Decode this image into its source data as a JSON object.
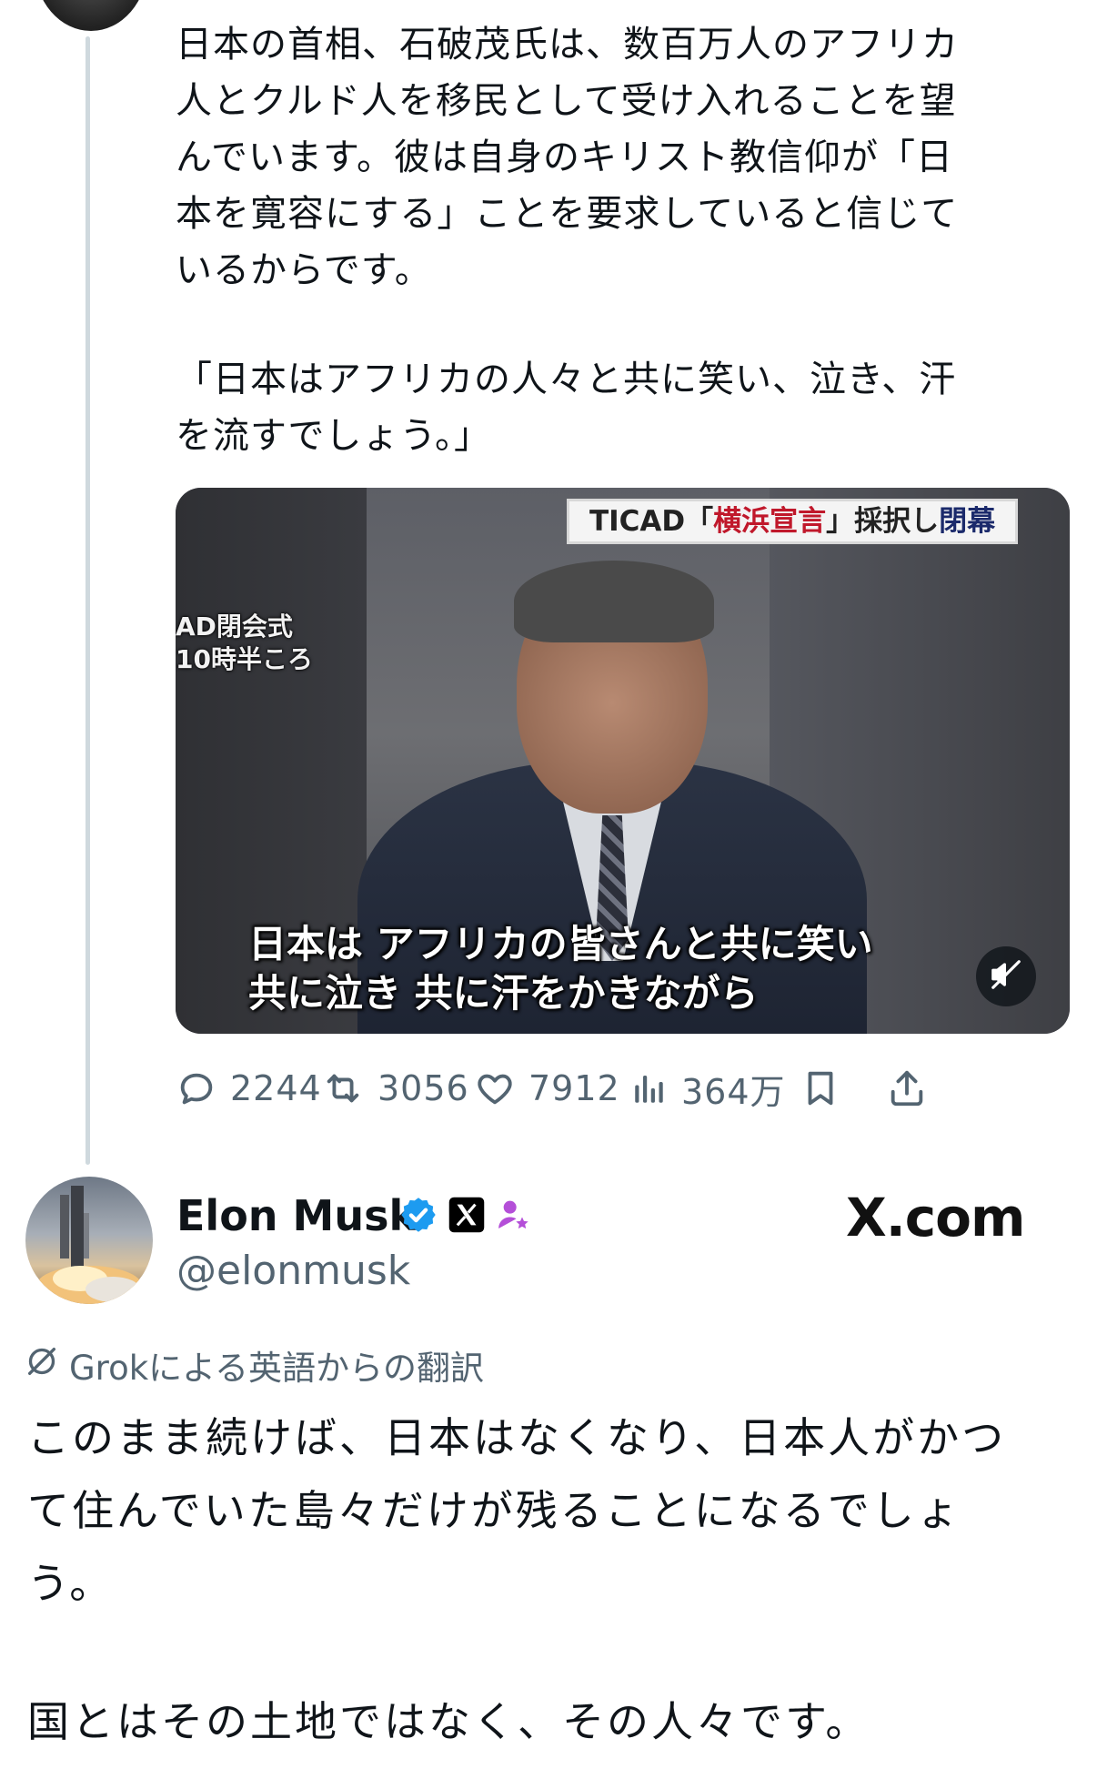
{
  "post": {
    "paragraph1": "日本の首相、石破茂氏は、数百万人のアフリカ\n人とクルド人を移民として受け入れることを望\nんでいます。彼は自身のキリスト教信仰が「日\n本を寛容にする」ことを要求していると信じて\nいるからです。",
    "quote": "「日本はアフリカの人々と共に笑い、泣き、汗\nを流すでしょう。」",
    "video": {
      "banner_prefix": "TICAD「",
      "banner_red": "横浜宣言",
      "banner_mid": "」採択し",
      "banner_end": "閉幕",
      "side_caption": "AD閉会式\n10時半ころ",
      "subtitle": "日本は アフリカの皆さんと共に笑い\n共に泣き 共に汗をかきながら"
    },
    "actions": {
      "replies": "2244",
      "reposts": "3056",
      "likes": "7912",
      "views": "364万"
    }
  },
  "reply": {
    "author_name": "Elon Musk",
    "author_handle": "@elonmusk",
    "watermark": "X.com",
    "translation_label": "Grokによる英語からの翻訳",
    "text1": "このまま続けば、日本はなくなり、日本人がかつ\nて住んでいた島々だけが残ることになるでしょ\nう。",
    "text2": "国とはその土地ではなく、その人々です。"
  },
  "colors": {
    "text": "#0f1419",
    "secondary": "#536471",
    "verified_blue": "#1d9bf0",
    "affiliate_purple": "#b44fd8",
    "thread_line": "#cfd9de"
  },
  "icons": {
    "reply": "comment-icon",
    "repost": "repost-icon",
    "like": "heart-icon",
    "views": "analytics-icon",
    "bookmark": "bookmark-icon",
    "share": "share-icon",
    "mute": "muted-speaker-icon",
    "verified": "verified-badge-icon",
    "affiliate": "x-affiliate-badge-icon",
    "subscriber": "subscriber-badge-icon",
    "grok": "grok-icon"
  }
}
